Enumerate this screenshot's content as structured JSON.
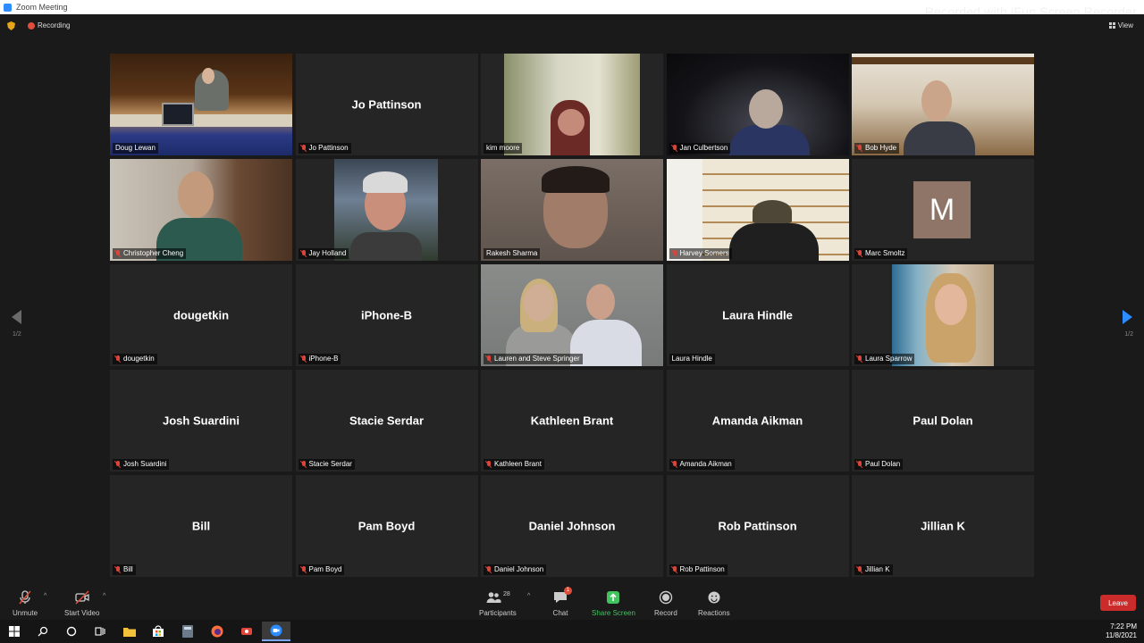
{
  "window": {
    "title": "Zoom Meeting",
    "watermark": "Recorded with iFun Screen Recorder"
  },
  "topbar": {
    "recording_label": "Recording",
    "view_label": "View"
  },
  "pager": {
    "left": "1/2",
    "right": "1/2"
  },
  "tiles": [
    {
      "name": "Doug Lewan",
      "big": "",
      "muted": false
    },
    {
      "name": "Jo Pattinson",
      "big": "Jo Pattinson",
      "muted": true
    },
    {
      "name": "kim moore",
      "big": "",
      "muted": false
    },
    {
      "name": "Jan Culbertson",
      "big": "",
      "muted": true
    },
    {
      "name": "Bob Hyde",
      "big": "",
      "muted": true
    },
    {
      "name": "Christopher Cheng",
      "big": "",
      "muted": true
    },
    {
      "name": "Jay Holland",
      "big": "",
      "muted": true
    },
    {
      "name": "Rakesh Sharma",
      "big": "",
      "muted": false
    },
    {
      "name": "Harvey Somers",
      "big": "",
      "muted": true
    },
    {
      "name": "Marc Smoltz",
      "big": "",
      "muted": true,
      "avatar": "M"
    },
    {
      "name": "dougetkin",
      "big": "dougetkin",
      "muted": true
    },
    {
      "name": "iPhone-B",
      "big": "iPhone-B",
      "muted": true
    },
    {
      "name": "Lauren and Steve Springer",
      "big": "",
      "muted": true
    },
    {
      "name": "Laura Hindle",
      "big": "Laura Hindle",
      "muted": false
    },
    {
      "name": "Laura Sparrow",
      "big": "",
      "muted": true
    },
    {
      "name": "Josh Suardini",
      "big": "Josh Suardini",
      "muted": true
    },
    {
      "name": "Stacie Serdar",
      "big": "Stacie Serdar",
      "muted": true
    },
    {
      "name": "Kathleen Brant",
      "big": "Kathleen Brant",
      "muted": true
    },
    {
      "name": "Amanda Aikman",
      "big": "Amanda Aikman",
      "muted": true
    },
    {
      "name": "Paul Dolan",
      "big": "Paul Dolan",
      "muted": true
    },
    {
      "name": "Bill",
      "big": "Bill",
      "muted": true
    },
    {
      "name": "Pam Boyd",
      "big": "Pam Boyd",
      "muted": true
    },
    {
      "name": "Daniel Johnson",
      "big": "Daniel Johnson",
      "muted": true
    },
    {
      "name": "Rob Pattinson",
      "big": "Rob Pattinson",
      "muted": true
    },
    {
      "name": "Jillian K",
      "big": "Jillian K",
      "muted": true
    }
  ],
  "toolbar": {
    "unmute": "Unmute",
    "start_video": "Start Video",
    "participants": "Participants",
    "participants_count": "28",
    "chat": "Chat",
    "chat_badge": "1",
    "share_screen": "Share Screen",
    "record": "Record",
    "reactions": "Reactions",
    "leave": "Leave",
    "share_color": "#41c45d",
    "leave_color": "#cc2b2b"
  },
  "taskbar": {
    "time": "7:22 PM",
    "date": "11/8/2021"
  }
}
